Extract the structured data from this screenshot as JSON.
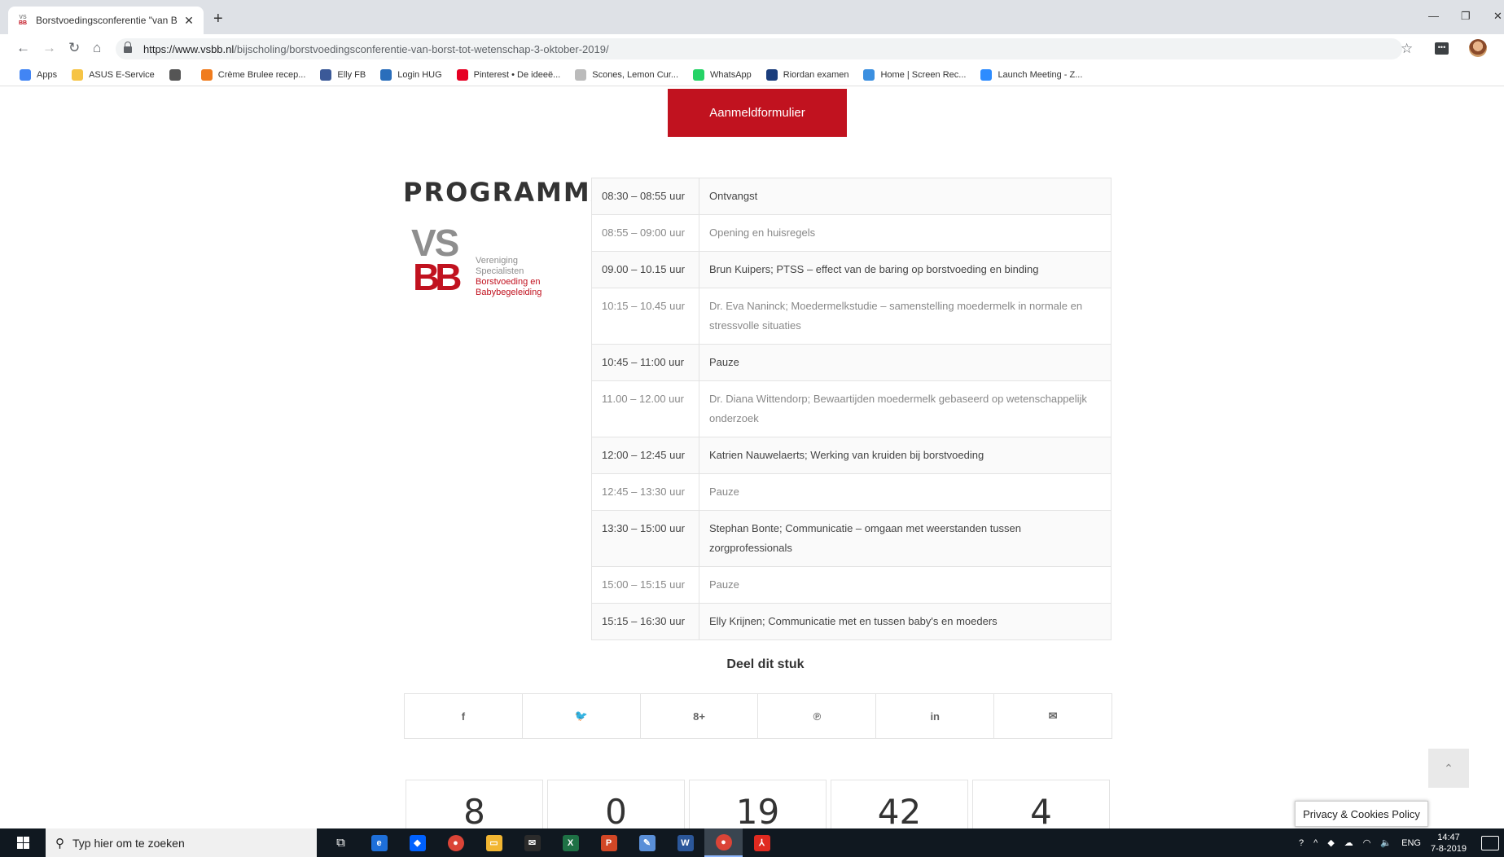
{
  "browser": {
    "tab_title": "Borstvoedingsconferentie \"van B",
    "url_host": "https://www.vsbb.nl",
    "url_path": "/bijscholing/borstvoedingsconferentie-van-borst-tot-wetenschap-3-oktober-2019/",
    "new_tab": "+",
    "bookmarks": [
      {
        "label": "Apps",
        "icon": "apps-grid-icon",
        "color": "#4285f4"
      },
      {
        "label": "ASUS E-Service",
        "icon": "folder-icon",
        "color": "#f6c445"
      },
      {
        "label": "",
        "icon": "globe-icon",
        "color": "#555555"
      },
      {
        "label": "Crème Brulee recep...",
        "icon": "recipe-icon",
        "color": "#f07c1e"
      },
      {
        "label": "Elly FB",
        "icon": "facebook-icon",
        "color": "#3b5998"
      },
      {
        "label": "Login HUG",
        "icon": "hug-icon",
        "color": "#2a6ebb"
      },
      {
        "label": "Pinterest • De ideeë...",
        "icon": "pinterest-icon",
        "color": "#e60023"
      },
      {
        "label": "Scones, Lemon Cur...",
        "icon": "scones-icon",
        "color": "#bbbbbb"
      },
      {
        "label": "WhatsApp",
        "icon": "whatsapp-icon",
        "color": "#25d366"
      },
      {
        "label": "Riordan examen",
        "icon": "riordan-icon",
        "color": "#1a3d7c"
      },
      {
        "label": "Home | Screen Rec...",
        "icon": "screenrec-icon",
        "color": "#3b8fe0"
      },
      {
        "label": "Launch Meeting - Z...",
        "icon": "zoom-icon",
        "color": "#2d8cff"
      }
    ]
  },
  "page": {
    "register_button": "Aanmeldformulier",
    "program_title": "PROGRAMMA",
    "logo": {
      "vs": "VS",
      "bb": "BB",
      "line1": "Vereniging",
      "line2": "Specialisten",
      "line3": "Borstvoeding en",
      "line4": "Babybegeleiding"
    },
    "schedule": [
      {
        "time": "08:30 – 08:55 uur",
        "item": "Ontvangst",
        "style": "dark"
      },
      {
        "time": "08:55 – 09:00 uur",
        "item": "Opening en huisregels",
        "style": "light"
      },
      {
        "time": "09.00 – 10.15 uur",
        "item": "Brun Kuipers; PTSS – effect van de baring op borstvoeding en binding",
        "style": "dark"
      },
      {
        "time": "10:15 – 10.45 uur",
        "item": "Dr. Eva Naninck; Moedermelkstudie – samenstelling moedermelk in normale en stressvolle situaties",
        "style": "light"
      },
      {
        "time": "10:45 – 11:00 uur",
        "item": "Pauze",
        "style": "dark"
      },
      {
        "time": "11.00 – 12.00 uur",
        "item": "Dr. Diana Wittendorp; Bewaartijden moedermelk gebaseerd op wetenschappelijk onderzoek",
        "style": "light"
      },
      {
        "time": "12:00 – 12:45 uur",
        "item": "Katrien Nauwelaerts; Werking van kruiden bij borstvoeding",
        "style": "dark"
      },
      {
        "time": "12:45 – 13:30 uur",
        "item": "Pauze",
        "style": "light"
      },
      {
        "time": "13:30 – 15:00 uur",
        "item": "Stephan Bonte; Communicatie – omgaan met weerstanden tussen zorgprofessionals",
        "style": "dark"
      },
      {
        "time": "15:00 – 15:15 uur",
        "item": "Pauze",
        "style": "light"
      },
      {
        "time": "15:15 – 16:30 uur",
        "item": "Elly Krijnen; Communicatie met en tussen baby's en moeders",
        "style": "dark"
      }
    ],
    "share_title": "Deel dit stuk",
    "share_buttons": [
      {
        "glyph": "f",
        "icon": "facebook-share-icon"
      },
      {
        "glyph": "🐦",
        "icon": "twitter-share-icon"
      },
      {
        "glyph": "8+",
        "icon": "googleplus-share-icon"
      },
      {
        "glyph": "℗",
        "icon": "pinterest-share-icon"
      },
      {
        "glyph": "in",
        "icon": "linkedin-share-icon"
      },
      {
        "glyph": "✉",
        "icon": "mail-share-icon"
      }
    ],
    "counters": [
      "8",
      "0",
      "19",
      "42",
      "4"
    ],
    "scroll_top": "⌃",
    "privacy_badge": "Privacy & Cookies Policy"
  },
  "taskbar": {
    "search_placeholder": "Typ hier om te zoeken",
    "language": "ENG",
    "time": "14:47",
    "date": "7-8-2019"
  },
  "colors": {
    "brand_red": "#c1121f",
    "brand_grey": "#8e8e8e"
  }
}
